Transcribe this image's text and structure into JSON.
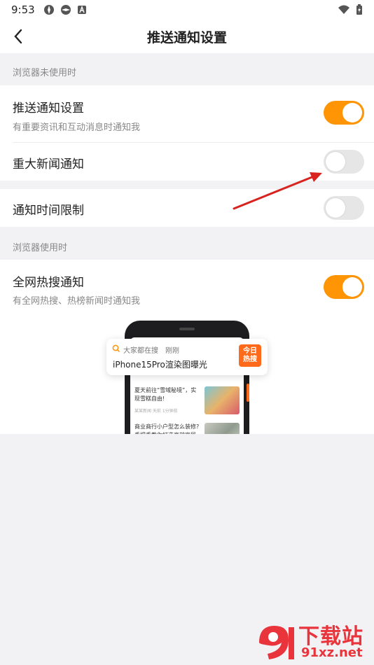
{
  "status_bar": {
    "time": "9:53"
  },
  "header": {
    "title": "推送通知设置",
    "back_icon": "chevron-left-icon"
  },
  "sections": [
    {
      "label": "浏览器未使用时"
    },
    {
      "label": "浏览器使用时"
    }
  ],
  "settings": [
    {
      "title": "推送通知设置",
      "subtitle": "有重要资讯和互动消息时通知我",
      "on": true
    },
    {
      "title": "重大新闻通知",
      "on": false
    },
    {
      "title": "通知时间限制",
      "on": false
    },
    {
      "title": "全网热搜通知",
      "subtitle": "有全网热搜、热榜新闻时通知我",
      "on": true
    }
  ],
  "preview": {
    "notification": {
      "source": "大家都在搜",
      "time": "刚刚",
      "title": "iPhone15Pro渲染图曝光",
      "badge": "今日\n热搜"
    },
    "news": [
      {
        "text": "夏天前往“雪域秘境”，实现雪糕自由!",
        "meta": "某某新闻 天前 1分钟前"
      },
      {
        "text": "商业商行小户型怎么装修?手把手教你打造高效家居",
        "meta": ""
      }
    ]
  },
  "watermark": {
    "text": "下载站",
    "url": "91xz.net"
  },
  "colors": {
    "accent": "#ff9405",
    "toggle_off": "#e6e6e6",
    "badge": "#ff6a1a",
    "watermark": "#e8343a"
  }
}
